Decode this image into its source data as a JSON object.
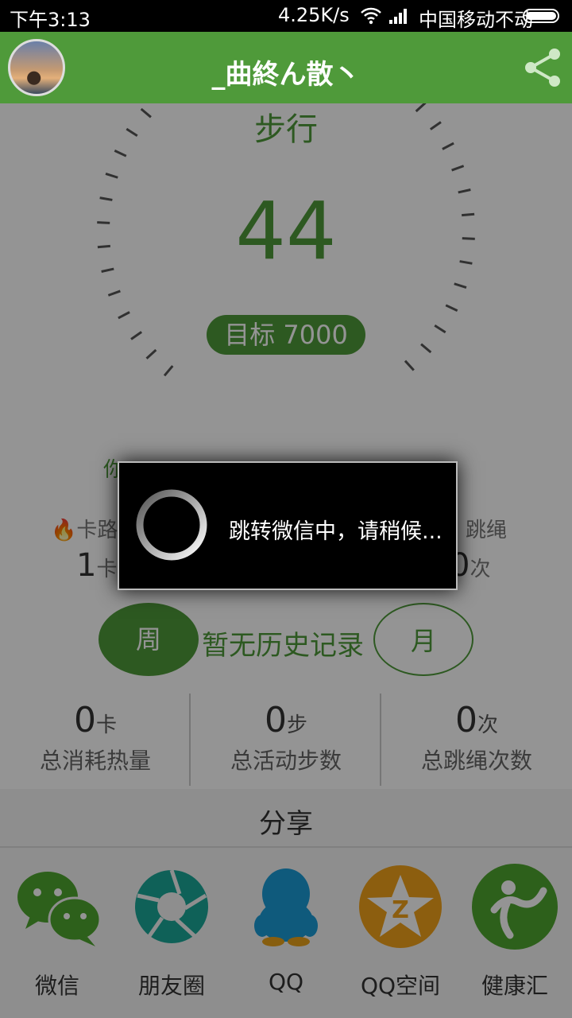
{
  "status_bar": {
    "time": "下午3:13",
    "net_speed": "4.25K/s",
    "carrier": "中国移动不动"
  },
  "header": {
    "title": "_曲終ん散丶"
  },
  "pedometer": {
    "mode_label": "步行",
    "steps": "44",
    "goal": "目标 7000"
  },
  "partial_stats": {
    "calorie_label": "卡路",
    "calorie_value": "1",
    "calorie_unit": "卡",
    "jump_label": "跳绳",
    "jump_value": "0",
    "jump_unit": "次"
  },
  "history": {
    "week_label": "周",
    "month_label": "月",
    "empty_text": "暂无历史记录"
  },
  "summary": [
    {
      "value": "0",
      "unit": "卡",
      "label": "总消耗热量"
    },
    {
      "value": "0",
      "unit": "步",
      "label": "总活动步数"
    },
    {
      "value": "0",
      "unit": "次",
      "label": "总跳绳次数"
    }
  ],
  "share": {
    "title": "分享",
    "items": [
      {
        "label": "微信",
        "icon": "wechat-icon",
        "color": "#4fa62f"
      },
      {
        "label": "朋友圈",
        "icon": "moments-icon",
        "color": "#1aa898"
      },
      {
        "label": "QQ",
        "icon": "qq-icon",
        "color": "#1b9bd6"
      },
      {
        "label": "QQ空间",
        "icon": "qzone-icon",
        "color": "#f2a31a"
      },
      {
        "label": "健康汇",
        "icon": "health-icon",
        "color": "#4fa62f"
      }
    ]
  },
  "dialog": {
    "message": "跳转微信中，请稍候..."
  },
  "colors": {
    "brand_green": "#4f9a3a",
    "overlay": "rgba(0,0,0,0.42)"
  }
}
